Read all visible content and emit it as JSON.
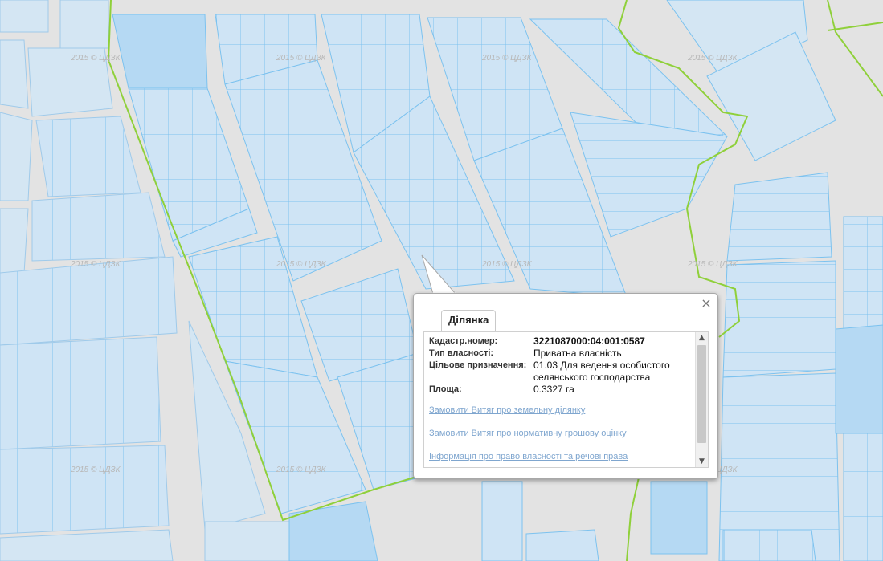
{
  "map": {
    "watermark_text": "2015 © ЦДЗК",
    "colors": {
      "background": "#e3e3e3",
      "parcel_fill": "#cfe4f5",
      "parcel_fill_dark": "#b5d9f3",
      "parcel_stroke": "#7cc2ef",
      "boundary": "#8fd03a"
    }
  },
  "popup": {
    "tab_label": "Ділянка",
    "close_label": "×",
    "fields": [
      {
        "label": "Кадастр.номер:",
        "value": "3221087000:04:001:0587"
      },
      {
        "label": "Тип власності:",
        "value": "Приватна власність"
      },
      {
        "label": "Цільове призначення:",
        "value": "01.03 Для ведення особистого селянського господарства"
      },
      {
        "label": "Площа:",
        "value": "0.3327 га"
      }
    ],
    "links": [
      "Замовити Витяг про земельну ділянку",
      "Замовити Витяг про нормативну грошову оцінку",
      "Інформація про право власності та речові права"
    ],
    "scroll_up": "▲",
    "scroll_down": "▼"
  }
}
